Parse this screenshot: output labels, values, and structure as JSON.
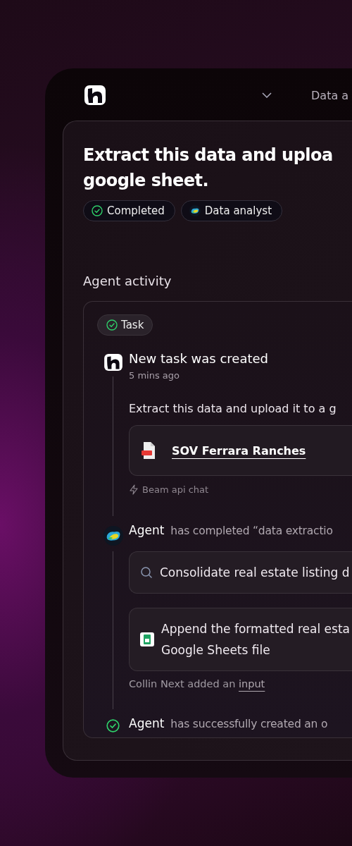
{
  "nav": {
    "label": "Data a"
  },
  "task": {
    "title_lines": [
      "Extract this data and uploa",
      "google sheet."
    ],
    "badges": [
      {
        "kind": "status",
        "label": "Completed"
      },
      {
        "kind": "agent",
        "label": "Data analyst"
      }
    ]
  },
  "activity": {
    "heading": "Agent activity",
    "chip": "Task",
    "events": [
      {
        "kind": "created",
        "title": "New task was created",
        "time": "5 mins ago",
        "message": "Extract this data and upload it to a g",
        "attachment": "SOV Ferrara Ranches",
        "source": "Beam api chat"
      },
      {
        "kind": "agent",
        "actor": "Agent",
        "action": "has completed “data extractio",
        "steps": [
          {
            "kind": "search",
            "lines": [
              "Consolidate real estate listing d"
            ]
          },
          {
            "kind": "sheet",
            "lines": [
              "Append the formatted real esta",
              "Google Sheets file"
            ]
          }
        ],
        "note": "Collin Next added an",
        "note_link": "input"
      },
      {
        "kind": "done",
        "actor": "Agent",
        "action": "has successfully created an o"
      }
    ]
  }
}
